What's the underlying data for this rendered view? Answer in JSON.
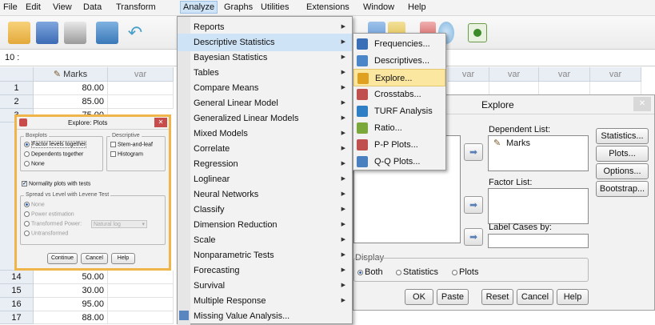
{
  "menubar": {
    "items": [
      "File",
      "Edit",
      "View",
      "Data",
      "Transform",
      "Analyze",
      "Graphs",
      "Utilities",
      "Extensions",
      "Window",
      "Help"
    ]
  },
  "cellref": {
    "label": "10 :"
  },
  "grid": {
    "columns": [
      "Marks",
      "var",
      "var",
      "var",
      "var",
      "var"
    ],
    "rows_top": [
      {
        "num": "1",
        "val": "80.00"
      },
      {
        "num": "2",
        "val": "85.00"
      },
      {
        "num": "3",
        "val": "75.00"
      }
    ],
    "rows_bottom": [
      {
        "num": "14",
        "val": "50.00"
      },
      {
        "num": "15",
        "val": "30.00"
      },
      {
        "num": "16",
        "val": "95.00"
      },
      {
        "num": "17",
        "val": "88.00"
      }
    ]
  },
  "analyze_menu": {
    "items": [
      {
        "label": "Reports",
        "sub": true
      },
      {
        "label": "Descriptive Statistics",
        "sub": true
      },
      {
        "label": "Bayesian Statistics",
        "sub": true
      },
      {
        "label": "Tables",
        "sub": true
      },
      {
        "label": "Compare Means",
        "sub": true
      },
      {
        "label": "General Linear Model",
        "sub": true
      },
      {
        "label": "Generalized Linear Models",
        "sub": true
      },
      {
        "label": "Mixed Models",
        "sub": true
      },
      {
        "label": "Correlate",
        "sub": true
      },
      {
        "label": "Regression",
        "sub": true
      },
      {
        "label": "Loglinear",
        "sub": true
      },
      {
        "label": "Neural Networks",
        "sub": true
      },
      {
        "label": "Classify",
        "sub": true
      },
      {
        "label": "Dimension Reduction",
        "sub": true
      },
      {
        "label": "Scale",
        "sub": true
      },
      {
        "label": "Nonparametric Tests",
        "sub": true
      },
      {
        "label": "Forecasting",
        "sub": true
      },
      {
        "label": "Survival",
        "sub": true
      },
      {
        "label": "Multiple Response",
        "sub": true
      },
      {
        "label": "Missing Value Analysis...",
        "sub": false
      }
    ]
  },
  "descriptive_submenu": {
    "items": [
      {
        "label": "Frequencies...",
        "icon": "frequencies-icon",
        "color": "#3a6fb8"
      },
      {
        "label": "Descriptives...",
        "icon": "descriptives-icon",
        "color": "#4a86c8"
      },
      {
        "label": "Explore...",
        "icon": "explore-icon",
        "color": "#e0a020"
      },
      {
        "label": "Crosstabs...",
        "icon": "crosstabs-icon",
        "color": "#c0504d"
      },
      {
        "label": "TURF Analysis",
        "icon": "turf-icon",
        "color": "#2f7fc4"
      },
      {
        "label": "Ratio...",
        "icon": "ratio-icon",
        "color": "#7aa83a"
      },
      {
        "label": "P-P Plots...",
        "icon": "pp-plots-icon",
        "color": "#c0504d"
      },
      {
        "label": "Q-Q Plots...",
        "icon": "qq-plots-icon",
        "color": "#4a7fc0"
      }
    ]
  },
  "explore_dialog": {
    "title": "Explore",
    "dependent_label": "Dependent List:",
    "dependent_item": "Marks",
    "factor_label": "Factor List:",
    "label_cases": "Label Cases by:",
    "side_buttons": [
      "Statistics...",
      "Plots...",
      "Options...",
      "Bootstrap..."
    ],
    "display_label": "Display",
    "display_options": [
      "Both",
      "Statistics",
      "Plots"
    ],
    "bottom_buttons": [
      "OK",
      "Paste",
      "Reset",
      "Cancel",
      "Help"
    ]
  },
  "plots_dialog": {
    "title": "Explore: Plots",
    "boxplots_title": "Boxplots",
    "boxplot_options": [
      "Factor levels together",
      "Dependents together",
      "None"
    ],
    "descriptive_title": "Descriptive",
    "descriptive_options": [
      "Stem-and-leaf",
      "Histogram"
    ],
    "normality": "Normality plots with tests",
    "spread_title": "Spread vs Level with Levene Test",
    "spread_options": [
      "None",
      "Power estimation",
      "Transformed",
      "Untransformed"
    ],
    "power_label": "Power:",
    "power_value": "Natural log",
    "buttons": [
      "Continue",
      "Cancel",
      "Help"
    ]
  },
  "colors": {
    "menu_highlight": "#cfe3f7",
    "submenu_highlight": "#fbe7a0",
    "plots_border": "#f0b54a"
  }
}
